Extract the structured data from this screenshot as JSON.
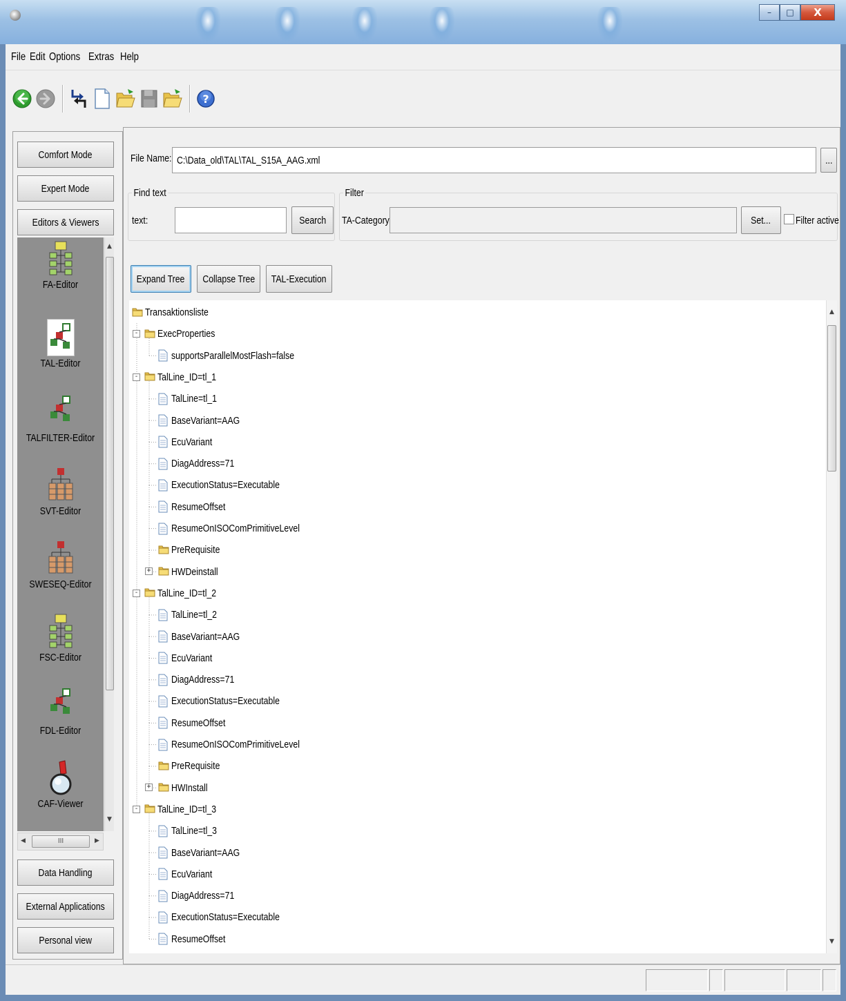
{
  "window": {
    "minimize": "–",
    "maximize": "□",
    "close": "X"
  },
  "menu": [
    "File",
    "Edit",
    "Options",
    "Extras",
    "Help"
  ],
  "toolbar": {
    "icons": [
      "back-icon",
      "forward-icon",
      "swap-icon",
      "new-file-icon",
      "open-folder-icon",
      "save-icon",
      "open-folder-icon",
      "help-icon"
    ]
  },
  "left_panel": {
    "modes": [
      "Comfort Mode",
      "Expert Mode",
      "Editors & Viewers"
    ],
    "editors": [
      "FA-Editor",
      "TAL-Editor",
      "TALFILTER-Editor",
      "SVT-Editor",
      "SWESEQ-Editor",
      "FSC-Editor",
      "FDL-Editor",
      "CAF-Viewer"
    ],
    "selected_editor": "TAL-Editor",
    "scroll_thumb_grip": "III",
    "bottom_buttons": [
      "Data Handling",
      "External Applications",
      "Personal view"
    ]
  },
  "file": {
    "label": "File Name:",
    "value": "C:\\Data_old\\TAL\\TAL_S15A_AAG.xml",
    "browse": "..."
  },
  "find": {
    "group": "Find text",
    "label": "text:",
    "value": "",
    "button": "Search"
  },
  "filter": {
    "group": "Filter",
    "label": "TA-Category:",
    "value": "",
    "button": "Set...",
    "checkbox_label": "Filter active",
    "checked": false
  },
  "actions": [
    "Expand Tree",
    "Collapse Tree",
    "TAL-Execution"
  ],
  "tree": [
    {
      "label": "Transaktionsliste",
      "depth": 0,
      "type": "folder",
      "exp": ""
    },
    {
      "label": "ExecProperties",
      "depth": 1,
      "type": "folder",
      "exp": "-"
    },
    {
      "label": "supportsParallelMostFlash=false",
      "depth": 2,
      "type": "file",
      "exp": ""
    },
    {
      "label": "TalLine_ID=tl_1",
      "depth": 1,
      "type": "folder",
      "exp": "-"
    },
    {
      "label": "TalLine=tl_1",
      "depth": 2,
      "type": "file",
      "exp": ""
    },
    {
      "label": "BaseVariant=AAG",
      "depth": 2,
      "type": "file",
      "exp": ""
    },
    {
      "label": "EcuVariant",
      "depth": 2,
      "type": "file",
      "exp": ""
    },
    {
      "label": "DiagAddress=71",
      "depth": 2,
      "type": "file",
      "exp": ""
    },
    {
      "label": "ExecutionStatus=Executable",
      "depth": 2,
      "type": "file",
      "exp": ""
    },
    {
      "label": "ResumeOffset",
      "depth": 2,
      "type": "file",
      "exp": ""
    },
    {
      "label": "ResumeOnISOComPrimitiveLevel",
      "depth": 2,
      "type": "file",
      "exp": ""
    },
    {
      "label": "PreRequisite",
      "depth": 2,
      "type": "folder",
      "exp": ""
    },
    {
      "label": "HWDeinstall",
      "depth": 2,
      "type": "folder",
      "exp": "+"
    },
    {
      "label": "TalLine_ID=tl_2",
      "depth": 1,
      "type": "folder",
      "exp": "-"
    },
    {
      "label": "TalLine=tl_2",
      "depth": 2,
      "type": "file",
      "exp": ""
    },
    {
      "label": "BaseVariant=AAG",
      "depth": 2,
      "type": "file",
      "exp": ""
    },
    {
      "label": "EcuVariant",
      "depth": 2,
      "type": "file",
      "exp": ""
    },
    {
      "label": "DiagAddress=71",
      "depth": 2,
      "type": "file",
      "exp": ""
    },
    {
      "label": "ExecutionStatus=Executable",
      "depth": 2,
      "type": "file",
      "exp": ""
    },
    {
      "label": "ResumeOffset",
      "depth": 2,
      "type": "file",
      "exp": ""
    },
    {
      "label": "ResumeOnISOComPrimitiveLevel",
      "depth": 2,
      "type": "file",
      "exp": ""
    },
    {
      "label": "PreRequisite",
      "depth": 2,
      "type": "folder",
      "exp": ""
    },
    {
      "label": "HWInstall",
      "depth": 2,
      "type": "folder",
      "exp": "+"
    },
    {
      "label": "TalLine_ID=tl_3",
      "depth": 1,
      "type": "folder",
      "exp": "-"
    },
    {
      "label": "TalLine=tl_3",
      "depth": 2,
      "type": "file",
      "exp": ""
    },
    {
      "label": "BaseVariant=AAG",
      "depth": 2,
      "type": "file",
      "exp": ""
    },
    {
      "label": "EcuVariant",
      "depth": 2,
      "type": "file",
      "exp": ""
    },
    {
      "label": "DiagAddress=71",
      "depth": 2,
      "type": "file",
      "exp": ""
    },
    {
      "label": "ExecutionStatus=Executable",
      "depth": 2,
      "type": "file",
      "exp": ""
    },
    {
      "label": "ResumeOffset",
      "depth": 2,
      "type": "file",
      "exp": ""
    }
  ]
}
